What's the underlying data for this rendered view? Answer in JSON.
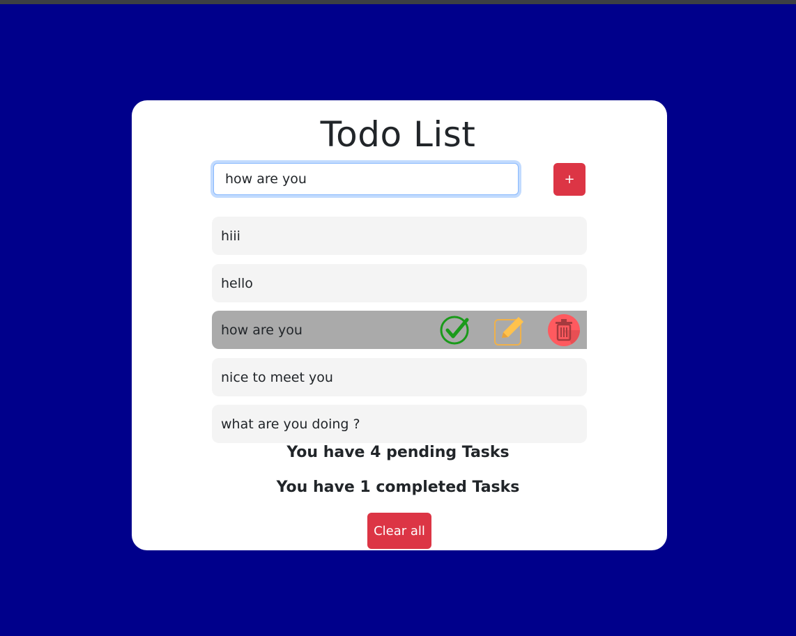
{
  "app": {
    "title": "Todo List"
  },
  "input": {
    "value": "how are you",
    "add_label": "+"
  },
  "tasks": [
    {
      "text": "hiii",
      "selected": false
    },
    {
      "text": "hello",
      "selected": false
    },
    {
      "text": "how are you",
      "selected": true
    },
    {
      "text": "nice to meet you",
      "selected": false
    },
    {
      "text": "what are you doing ?",
      "selected": false
    }
  ],
  "task_actions": {
    "complete_icon": "check-circle-icon",
    "edit_icon": "pencil-icon",
    "delete_icon": "trash-icon"
  },
  "status": {
    "pending": "You have 4 pending Tasks",
    "completed": "You have 1 completed Tasks"
  },
  "clear_label": "Clear all",
  "colors": {
    "background": "#00008b",
    "accent": "#dc3545",
    "task_bg": "#f4f4f4",
    "selected_task_bg": "#aaaaaa"
  }
}
